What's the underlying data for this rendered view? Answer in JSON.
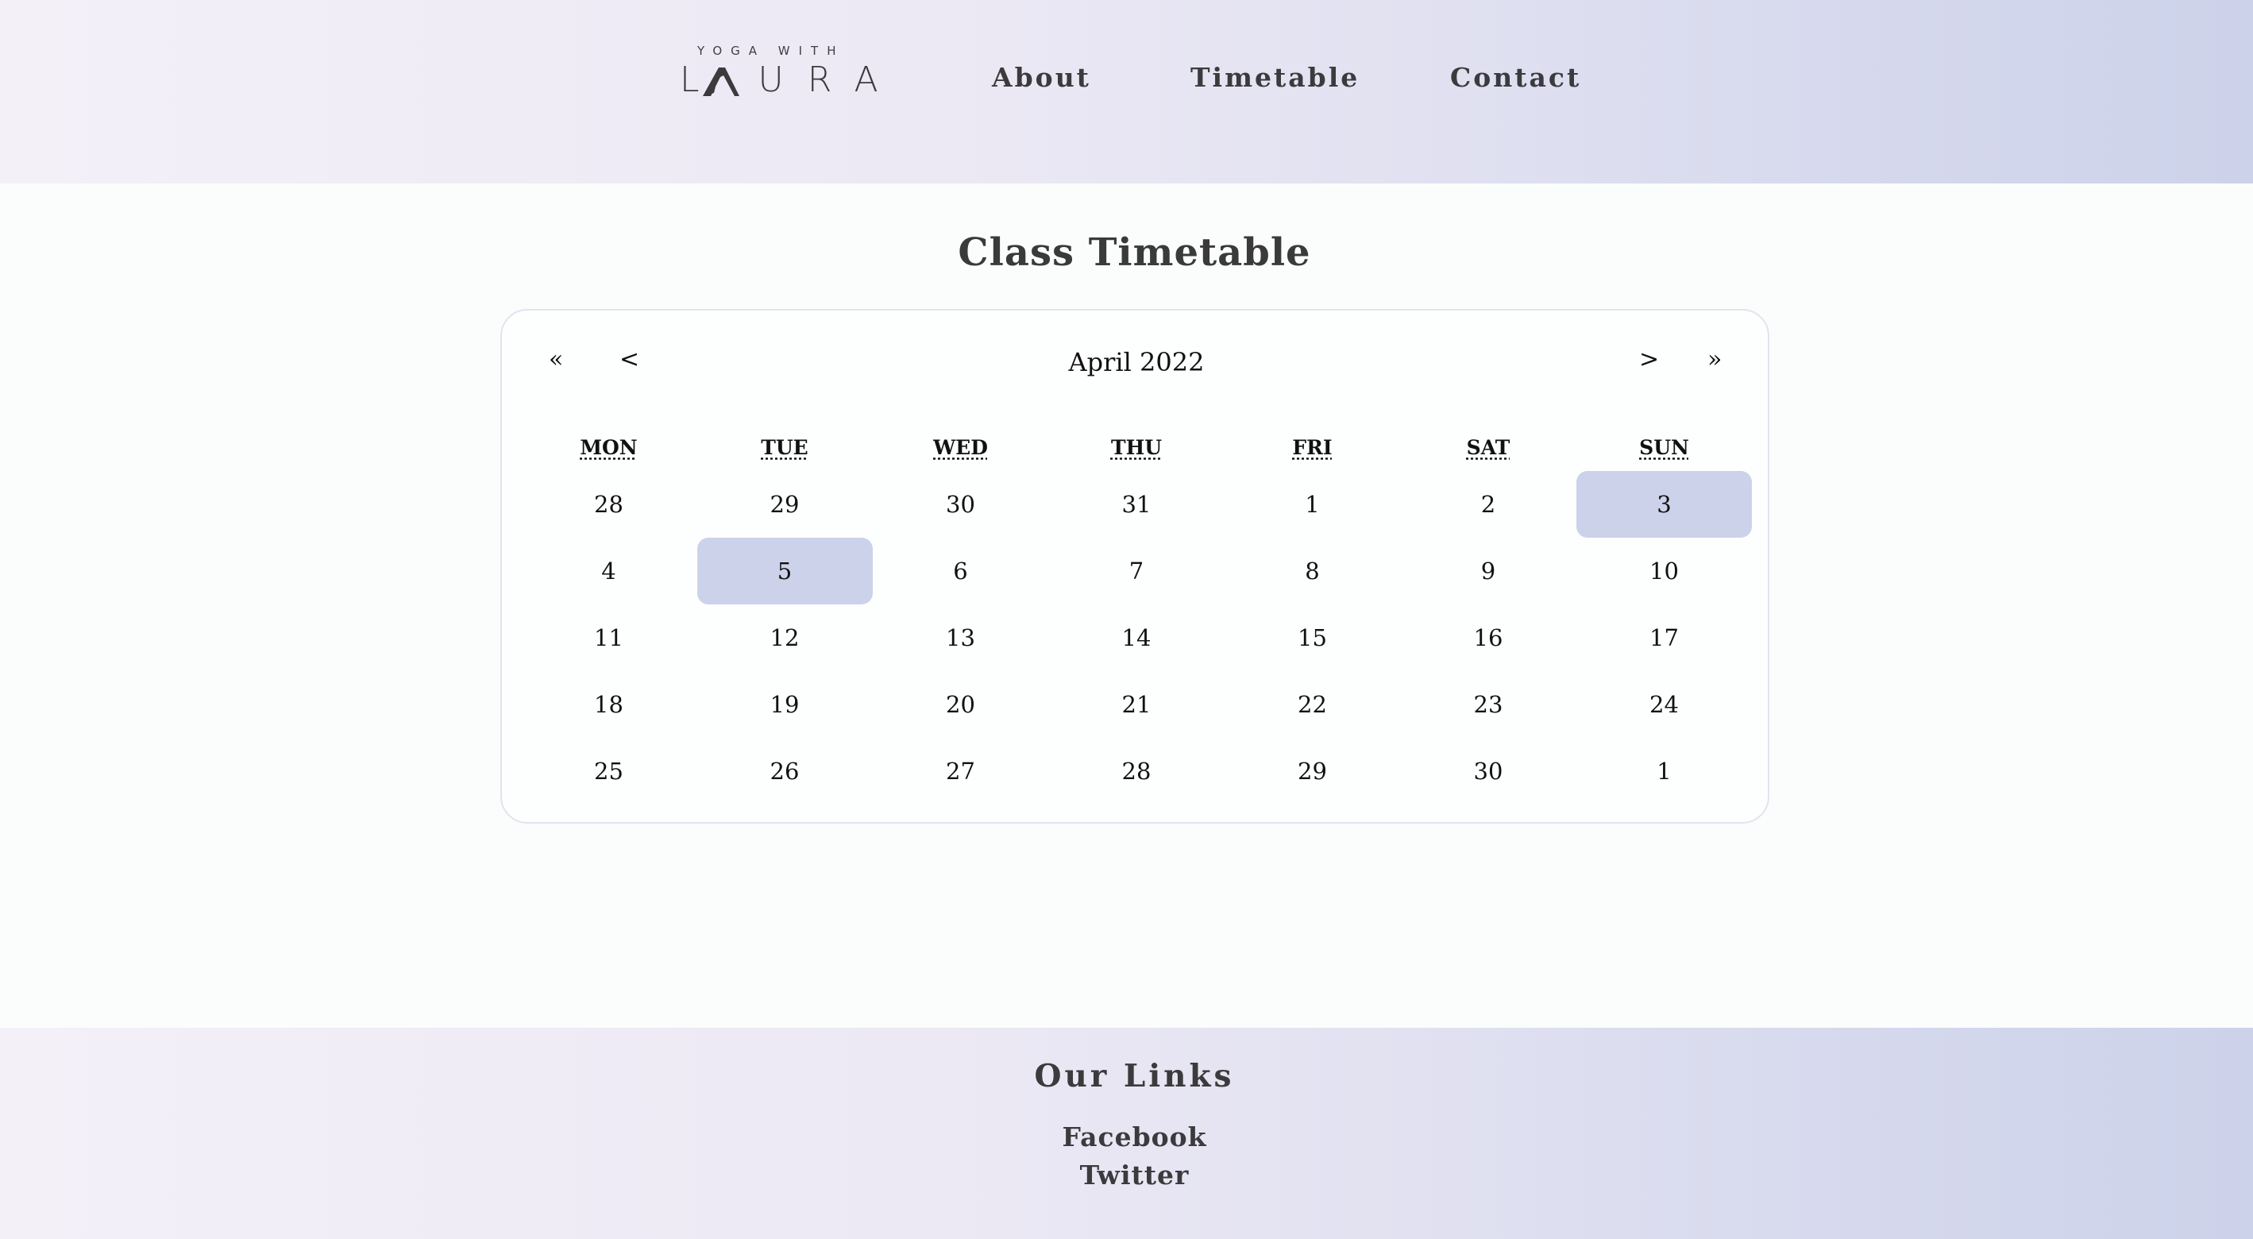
{
  "header": {
    "logo": {
      "top_text": "YOGA WITH",
      "main_text": "LAURA"
    },
    "nav": [
      {
        "label": "About"
      },
      {
        "label": "Timetable"
      },
      {
        "label": "Contact"
      }
    ]
  },
  "main": {
    "title": "Class Timetable",
    "calendar": {
      "prev_year": "«",
      "prev_month": "<",
      "month_label": "April 2022",
      "next_month": ">",
      "next_year": "»",
      "weekdays": [
        "MON",
        "TUE",
        "WED",
        "THU",
        "FRI",
        "SAT",
        "SUN"
      ],
      "weeks": [
        [
          "28",
          "29",
          "30",
          "31",
          "1",
          "2",
          "3"
        ],
        [
          "4",
          "5",
          "6",
          "7",
          "8",
          "9",
          "10"
        ],
        [
          "11",
          "12",
          "13",
          "14",
          "15",
          "16",
          "17"
        ],
        [
          "18",
          "19",
          "20",
          "21",
          "22",
          "23",
          "24"
        ],
        [
          "25",
          "26",
          "27",
          "28",
          "29",
          "30",
          "1"
        ]
      ],
      "highlighted_days": [
        "3",
        "5"
      ],
      "highlight_color": "#ccd2ea"
    }
  },
  "footer": {
    "title": "Our Links",
    "links": [
      {
        "label": "Facebook"
      },
      {
        "label": "Twitter"
      }
    ]
  },
  "colors": {
    "gradient_start": "#f4f0f8",
    "gradient_end": "#ccd2ea",
    "text": "#3b3b3d"
  }
}
